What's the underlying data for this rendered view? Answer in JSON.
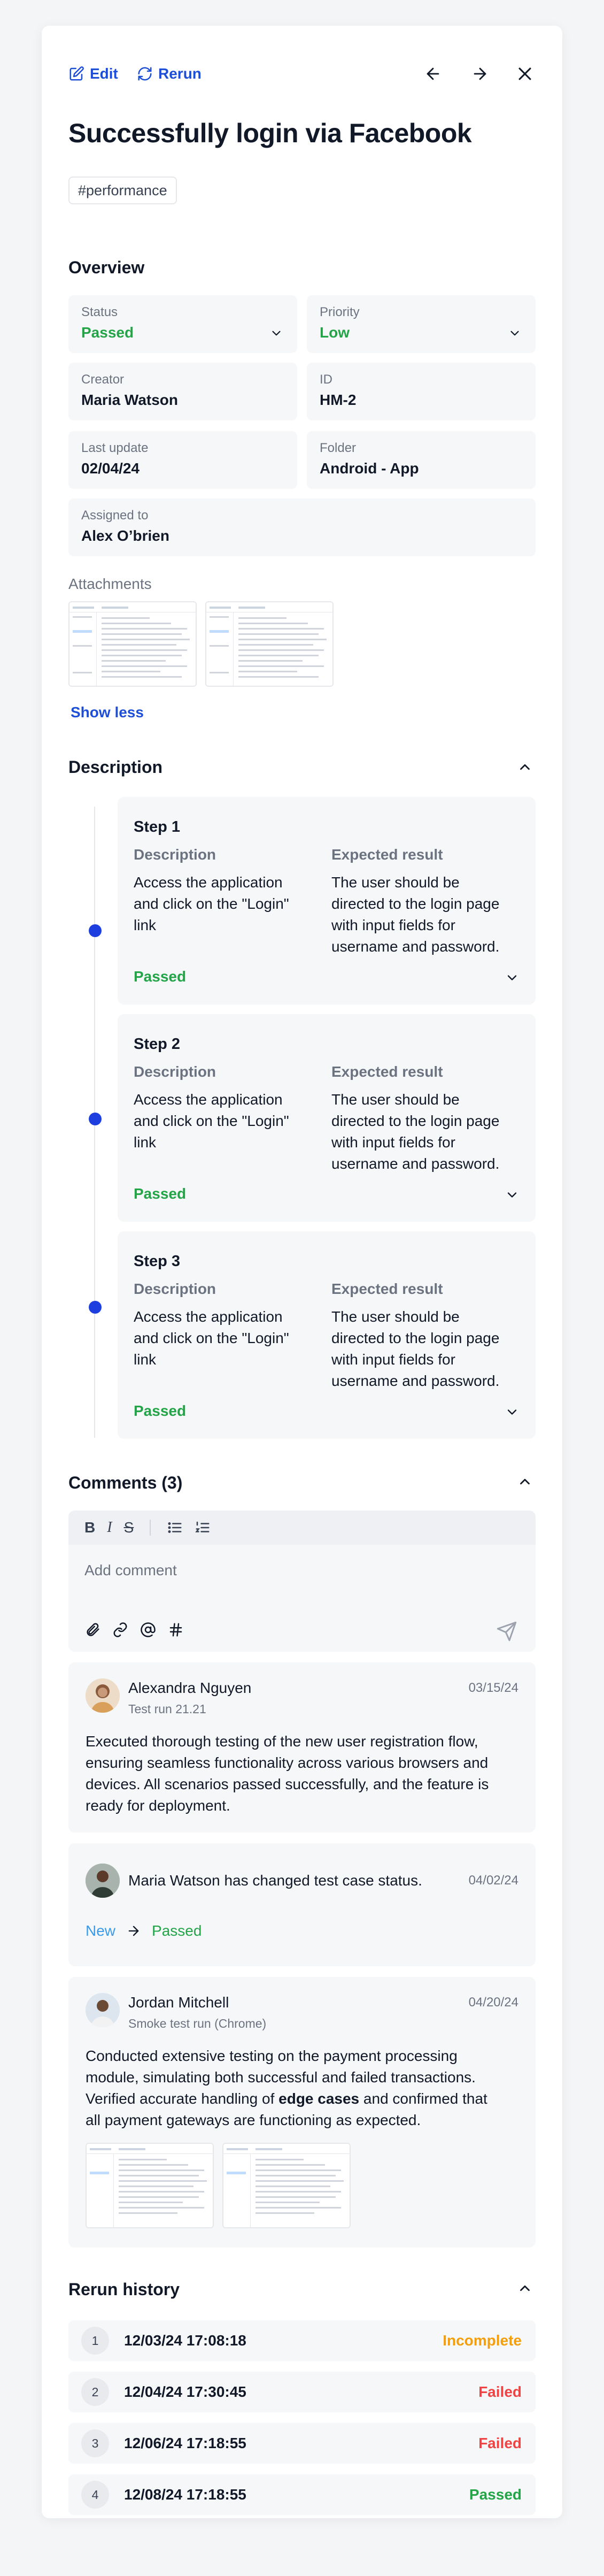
{
  "toolbar": {
    "edit_label": "Edit",
    "rerun_label": "Rerun"
  },
  "test": {
    "title": "Successfully login via Facebook",
    "tag": "#performance"
  },
  "overview": {
    "title": "Overview",
    "status": {
      "label": "Status",
      "value": "Passed"
    },
    "priority": {
      "label": "Priority",
      "value": "Low"
    },
    "creator": {
      "label": "Creator",
      "value": "Maria Watson"
    },
    "id": {
      "label": "ID",
      "value": "HM-2"
    },
    "last_update": {
      "label": "Last update",
      "value": "02/04/24"
    },
    "folder": {
      "label": "Folder",
      "value": "Android - App"
    },
    "assigned": {
      "label": "Assigned to",
      "value": "Alex O’brien"
    },
    "attachments_label": "Attachments",
    "show_less": "Show less"
  },
  "description": {
    "title": "Description",
    "col_description": "Description",
    "col_expected": "Expected result",
    "steps": [
      {
        "name": "Step 1",
        "desc": [
          "Access the application",
          "and click on the \"Login\"",
          "link"
        ],
        "expected": [
          "The user should be",
          "directed to the login page",
          "with input fields for",
          "username and password."
        ],
        "status": "Passed"
      },
      {
        "name": "Step 2",
        "desc": [
          "Access the application",
          "and click on the \"Login\"",
          "link"
        ],
        "expected": [
          "The user should be",
          "directed to the login page",
          "with input fields for",
          "username and password."
        ],
        "status": "Passed"
      },
      {
        "name": "Step 3",
        "desc": [
          "Access the application",
          "and click on the \"Login\"",
          "link"
        ],
        "expected": [
          "The user should be",
          "directed to the login page",
          "with input fields for",
          "username and password."
        ],
        "status": "Passed"
      }
    ]
  },
  "comments": {
    "title": "Comments (3)",
    "placeholder": "Add comment",
    "items": [
      {
        "name": "Alexandra Nguyen",
        "sub": "Test run 21.21",
        "date": "03/15/24",
        "body": [
          "Executed thorough testing of the new user registration flow,",
          "ensuring seamless functionality across various browsers and",
          "devices. All scenarios passed successfully, and the feature is",
          "ready for deployment."
        ]
      },
      {
        "name": "Maria Watson has changed test case status.",
        "date": "04/02/24",
        "from": "New",
        "to": "Passed"
      },
      {
        "name": "Jordan Mitchell",
        "sub": "Smoke test run (Chrome)",
        "date": "04/20/24",
        "body1": "Conducted extensive testing on the payment processing",
        "body2": "module, simulating both successful and failed transactions.",
        "body3_pre": "Verified accurate handling of ",
        "body3_bold": "edge cases",
        "body3_post": " and confirmed that",
        "body4": "all payment gateways are functioning as expected."
      }
    ]
  },
  "rerun": {
    "title": "Rerun history",
    "rows": [
      {
        "num": "1",
        "date": "12/03/24 17:08:18",
        "status": "Incomplete",
        "color": "#f59e0b"
      },
      {
        "num": "2",
        "date": "12/04/24 17:30:45",
        "status": "Failed",
        "color": "#ef4444"
      },
      {
        "num": "3",
        "date": "12/06/24 17:18:55",
        "status": "Failed",
        "color": "#ef4444"
      },
      {
        "num": "4",
        "date": "12/08/24 17:18:55",
        "status": "Passed",
        "color": "#22a447"
      }
    ]
  },
  "colors": {
    "accent": "#1d4ed8",
    "passed": "#22a447",
    "new": "#3b9be8"
  }
}
